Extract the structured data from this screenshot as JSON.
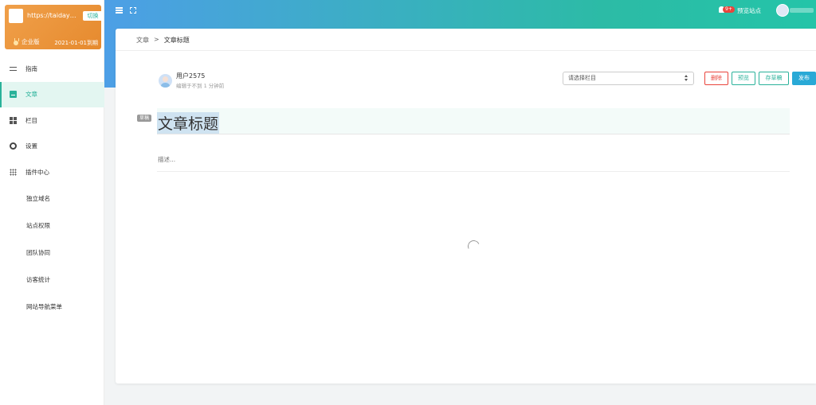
{
  "site": {
    "url": "https://taidayu....",
    "switch_label": "切换",
    "edition": "企业版",
    "expire": "2021-01-01到期"
  },
  "sidebar": {
    "items": [
      {
        "label": "指南",
        "icon": "guide-icon"
      },
      {
        "label": "文章",
        "icon": "article-icon",
        "active": true
      },
      {
        "label": "栏目",
        "icon": "columns-icon"
      },
      {
        "label": "设置",
        "icon": "gear-icon"
      },
      {
        "label": "插件中心",
        "icon": "plugin-icon"
      }
    ],
    "subitems": [
      "独立域名",
      "站点权限",
      "团队协同",
      "访客统计",
      "网站导航菜单"
    ]
  },
  "topbar": {
    "badge": "9+",
    "preview_site": "预览站点"
  },
  "breadcrumb": {
    "parent": "文章",
    "separator": ">",
    "current": "文章标题"
  },
  "author": {
    "name": "用户2575",
    "edited": "编辑于不到 1 分钟前"
  },
  "column_select": {
    "placeholder": "请选择栏目"
  },
  "actions": {
    "delete": "删除",
    "preview": "预览",
    "save_draft": "存草稿",
    "publish": "发布"
  },
  "editor": {
    "draft_tag": "草稿",
    "title": "文章标题",
    "description_placeholder": "描述..."
  },
  "colors": {
    "accent": "#2ab29a",
    "danger": "#e9443c",
    "publish": "#29a9d6"
  }
}
